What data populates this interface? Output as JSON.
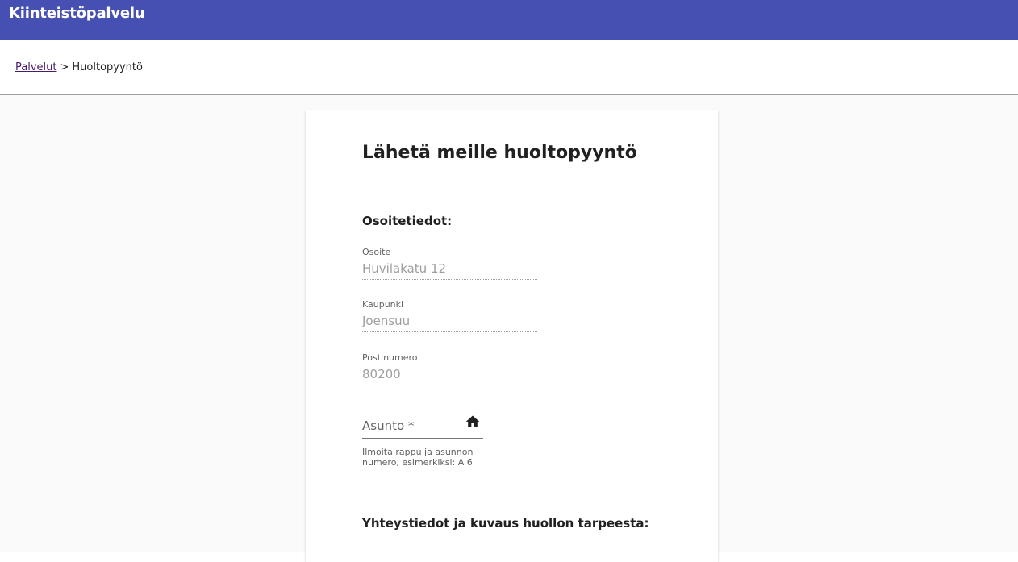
{
  "app": {
    "title": "Kiinteistöpalvelu"
  },
  "breadcrumb": {
    "parent": "Palvelut",
    "separator": ">",
    "current": "Huoltopyyntö"
  },
  "form": {
    "title": "Lähetä meille huoltopyyntö",
    "address_section": "Osoitetiedot:",
    "fields": {
      "osoite": {
        "label": "Osoite",
        "value": "Huvilakatu 12"
      },
      "kaupunki": {
        "label": "Kaupunki",
        "value": "Joensuu"
      },
      "postinumero": {
        "label": "Postinumero",
        "value": "80200"
      }
    },
    "asunto": {
      "placeholder": "Asunto *",
      "icon": "home-icon",
      "helper": "Ilmoita rappu ja asunnon numero, esimerkiksi: A 6"
    },
    "contact_section": "Yhteystiedot ja kuvaus huollon tarpeesta:"
  },
  "colors": {
    "header": "#4650b3",
    "link": "#4a1a6b",
    "muted_text": "#9e9e9e"
  }
}
